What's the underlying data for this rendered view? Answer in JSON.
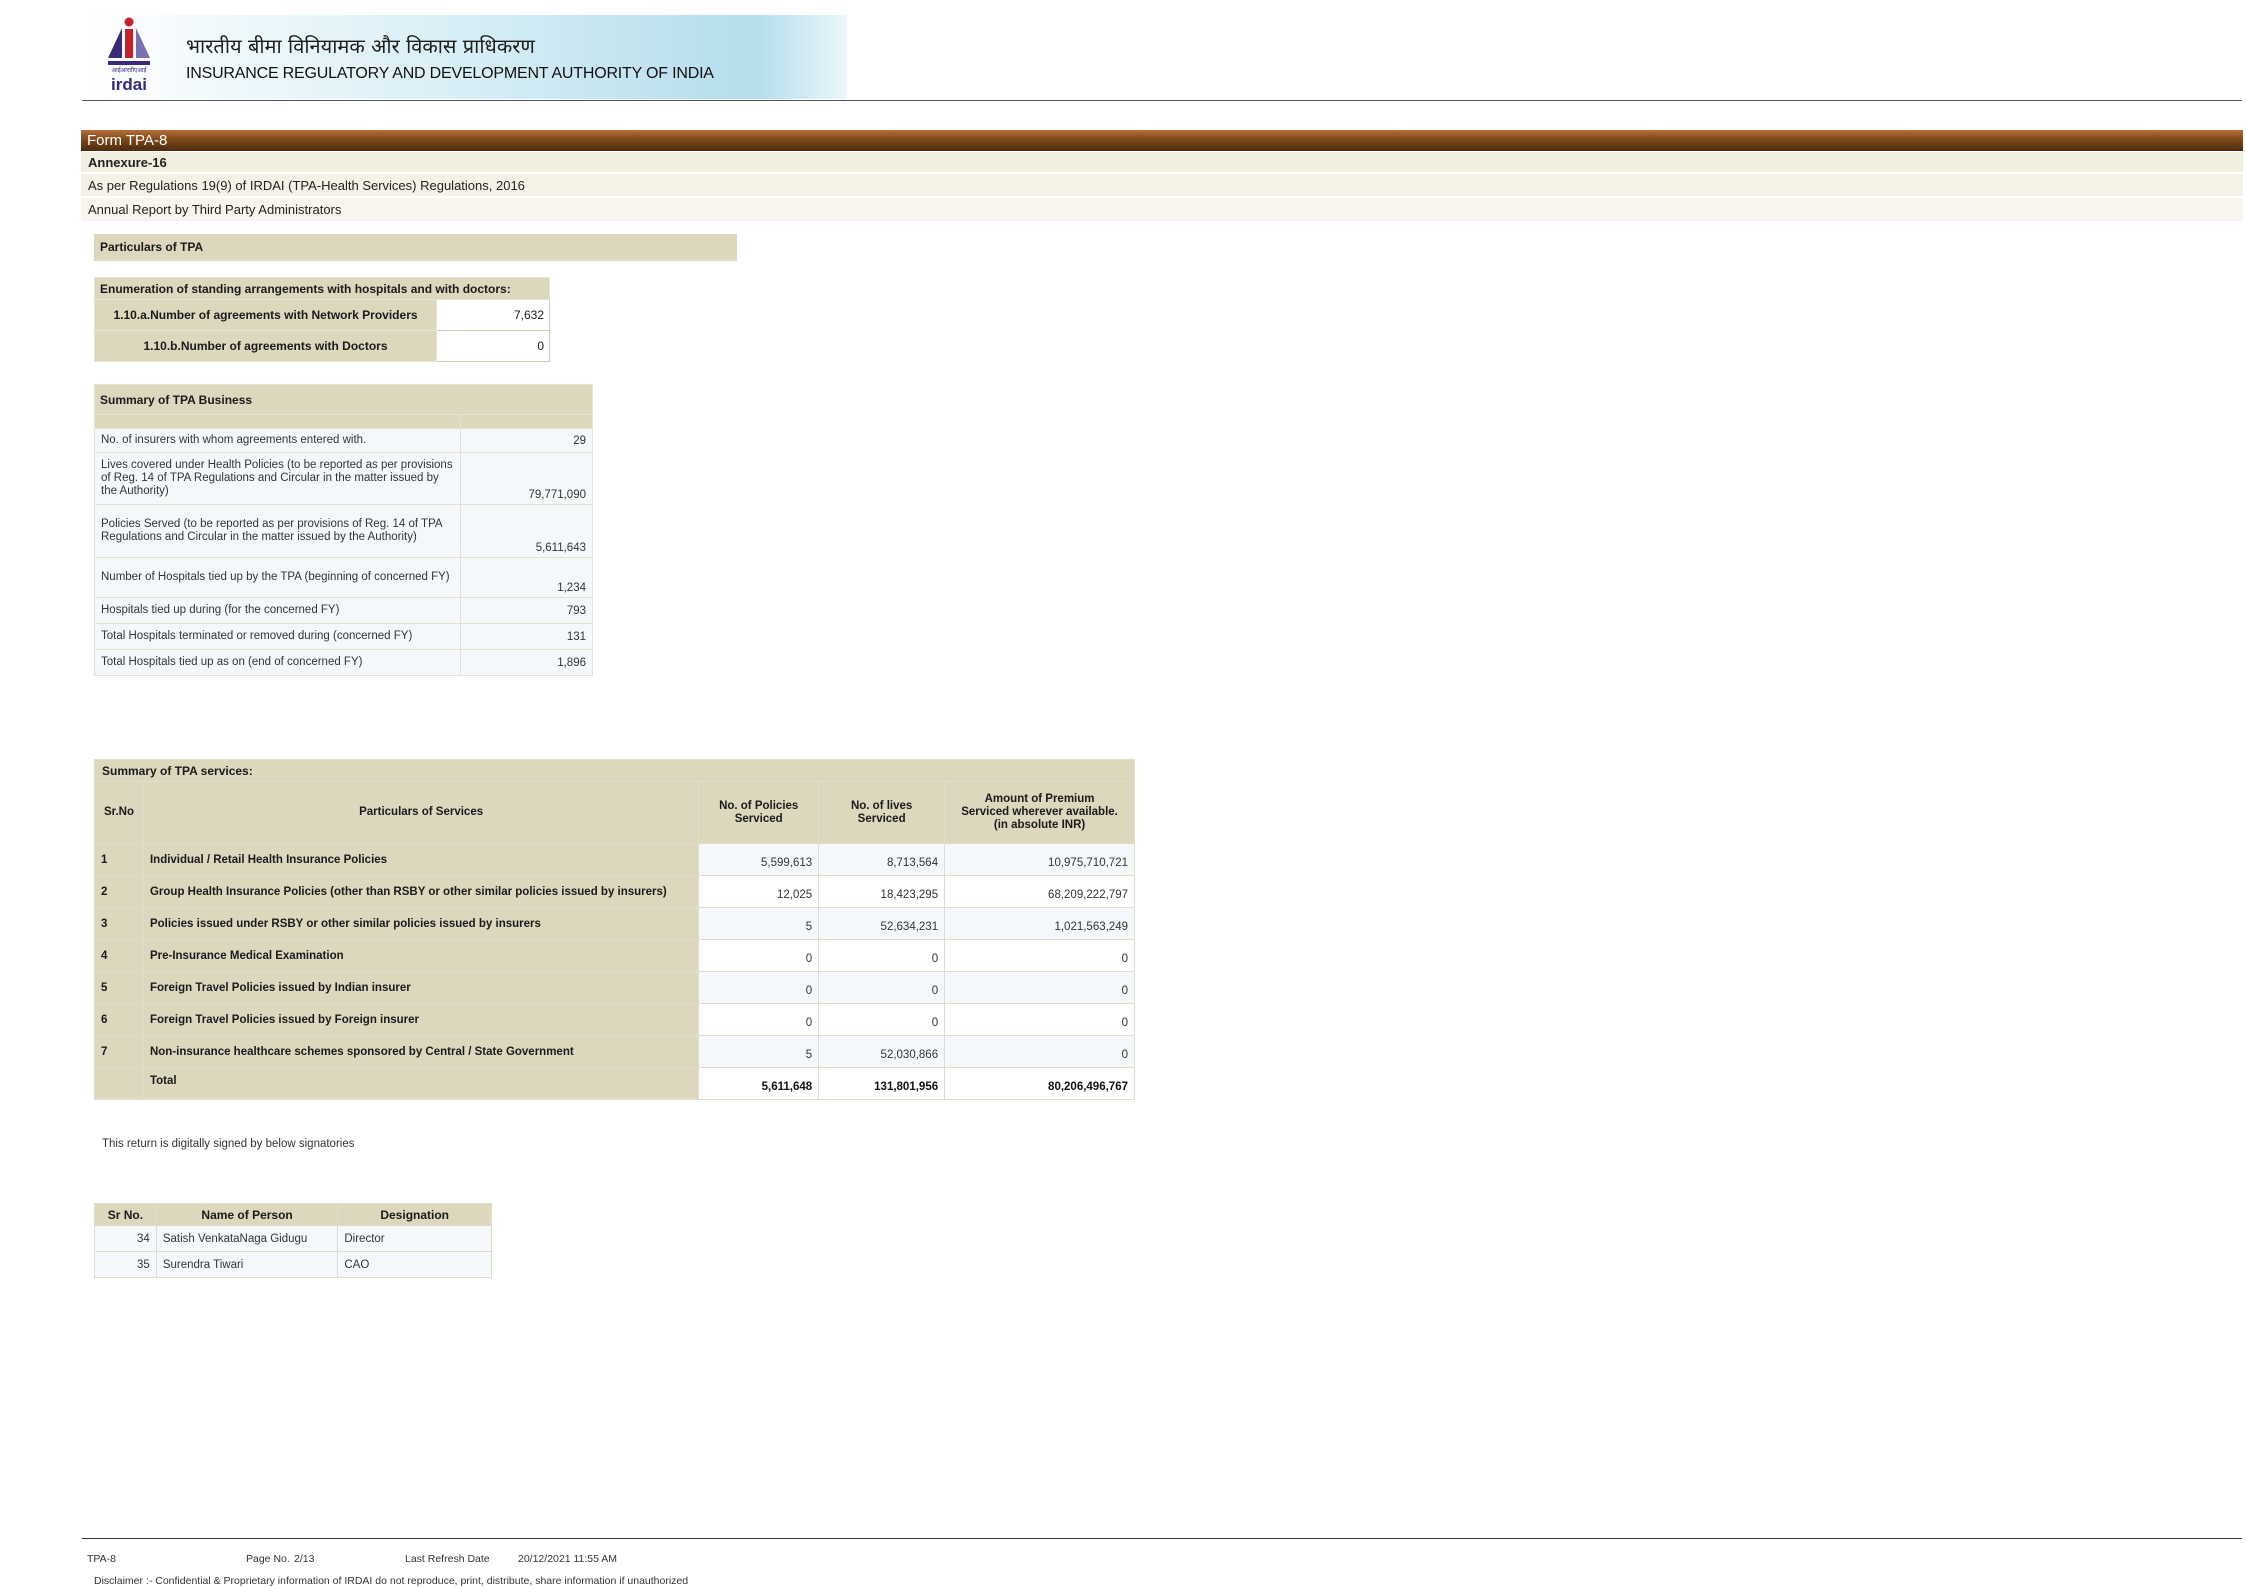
{
  "header": {
    "hindi_name": "भारतीय बीमा विनियामक और विकास प्राधिकरण",
    "english_name": "INSURANCE REGULATORY AND DEVELOPMENT AUTHORITY OF INDIA",
    "logo_text": "irdai",
    "logo_hindi_text": "आईआरडीएआई"
  },
  "form": {
    "title": "Form TPA-8",
    "annexure": "Annexure-16",
    "regulation": "As per Regulations 19(9) of IRDAI (TPA-Health Services) Regulations, 2016",
    "report": "Annual Report by Third Party Administrators"
  },
  "particulars_bar": "Particulars of TPA",
  "enumeration": {
    "header": "Enumeration of standing arrangements with hospitals and with doctors:",
    "rows": [
      {
        "label": "1.10.a.Number of agreements with Network Providers",
        "value": "7,632"
      },
      {
        "label": "1.10.b.Number of agreements with Doctors",
        "value": "0"
      }
    ]
  },
  "summary_business": {
    "header": "Summary of TPA Business",
    "rows": [
      {
        "label": "No. of insurers with whom agreements entered with.",
        "value": "29"
      },
      {
        "label": "Lives covered under Health Policies (to be reported as per provisions of Reg. 14 of TPA Regulations and Circular in the matter issued by the Authority)",
        "value": "79,771,090"
      },
      {
        "label": "Policies Served  (to be reported as per provisions of Reg. 14 of TPA Regulations and Circular in the matter issued by the Authority)",
        "value": "5,611,643"
      },
      {
        "label": "Number of Hospitals tied up by the TPA (beginning of concerned FY)",
        "value": "1,234"
      },
      {
        "label": "Hospitals tied up during (for the concerned FY)",
        "value": "793"
      },
      {
        "label": "Total Hospitals terminated or removed during (concerned FY)",
        "value": "131"
      },
      {
        "label": "Total Hospitals tied up as on (end of concerned FY)",
        "value": "1,896"
      }
    ]
  },
  "services": {
    "caption": "Summary of TPA services:",
    "columns": [
      "Sr.No",
      "Particulars of Services",
      "No. of Policies Serviced",
      "No. of lives Serviced",
      "Amount of Premium Serviced wherever available. (in absolute INR)"
    ],
    "rows": [
      {
        "sr": "1",
        "desc": "Individual / Retail Health Insurance Policies",
        "policies": "5,599,613",
        "lives": "8,713,564",
        "premium": "10,975,710,721"
      },
      {
        "sr": "2",
        "desc": "Group Health Insurance Policies (other than RSBY or other similar policies issued by insurers)",
        "policies": "12,025",
        "lives": "18,423,295",
        "premium": "68,209,222,797"
      },
      {
        "sr": "3",
        "desc": "Policies issued under RSBY or other similar policies issued by insurers",
        "policies": "5",
        "lives": "52,634,231",
        "premium": "1,021,563,249"
      },
      {
        "sr": "4",
        "desc": "Pre-Insurance Medical Examination",
        "policies": "0",
        "lives": "0",
        "premium": "0"
      },
      {
        "sr": "5",
        "desc": "Foreign Travel Policies issued by Indian insurer",
        "policies": "0",
        "lives": "0",
        "premium": "0"
      },
      {
        "sr": "6",
        "desc": "Foreign Travel Policies issued by Foreign insurer",
        "policies": "0",
        "lives": "0",
        "premium": "0"
      },
      {
        "sr": "7",
        "desc": "Non-insurance healthcare schemes sponsored by Central / State Government",
        "policies": "5",
        "lives": "52,030,866",
        "premium": "0"
      }
    ],
    "total": {
      "label": "Total",
      "policies": "5,611,648",
      "lives": "131,801,956",
      "premium": "80,206,496,767"
    }
  },
  "signed_note": "This return is digitally signed by below signatories",
  "signatories": {
    "columns": [
      "Sr No.",
      "Name of Person",
      "Designation"
    ],
    "rows": [
      {
        "sr": "34",
        "name": "Satish VenkataNaga Gidugu",
        "designation": "Director"
      },
      {
        "sr": "35",
        "name": "Surendra Tiwari",
        "designation": "CAO"
      }
    ]
  },
  "footer": {
    "form_code": "TPA-8",
    "page_label": "Page No.",
    "page_value": "2/13",
    "refresh_label": "Last Refresh Date",
    "refresh_value": "20/12/2021 11:55 AM",
    "disclaimer": "Disclaimer :- Confidential & Proprietary information of IRDAI do not reproduce, print, distribute, share information if unauthorized"
  },
  "colors": {
    "form_bar": "#7e4818",
    "section_beige": "#dcd7bd",
    "logo_purple": "#3b2a7a",
    "logo_red": "#c8202a"
  }
}
